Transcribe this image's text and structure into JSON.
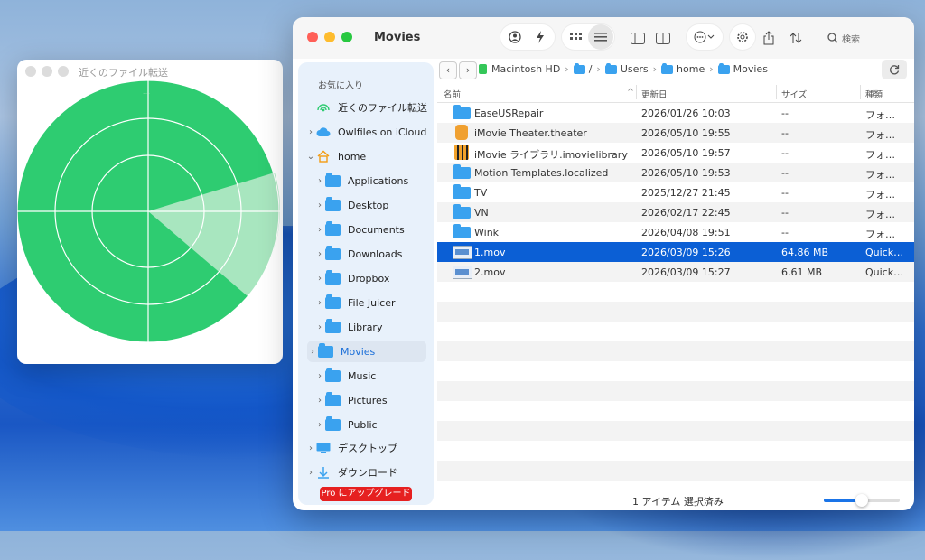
{
  "airdrop_window": {
    "title": "近くのファイル転送",
    "radar_label": "…",
    "colors": {
      "radar": "#2ecc71",
      "sweep": "#a8e6bf"
    }
  },
  "finder": {
    "title": "Movies",
    "search_placeholder": "検索",
    "toolbar_icons": [
      "person-circle-icon",
      "bolt-icon",
      "grid-view-icon",
      "list-view-icon",
      "sidebar-toggle-icon",
      "split-view-icon",
      "more-options-icon",
      "gear-icon",
      "share-icon",
      "sort-icon",
      "search-icon"
    ],
    "sidebar": {
      "section_title": "お気に入り",
      "items": [
        {
          "label": "近くのファイル転送",
          "icon": "airdrop-icon",
          "expandable": false
        },
        {
          "label": "Owlfiles on iCloud",
          "icon": "cloud-icon",
          "expandable": true
        },
        {
          "label": "home",
          "icon": "home-icon",
          "expandable": true,
          "expanded": true
        },
        {
          "label": "Applications",
          "icon": "folder-icon",
          "expandable": true,
          "child": true
        },
        {
          "label": "Desktop",
          "icon": "folder-icon",
          "expandable": true,
          "child": true
        },
        {
          "label": "Documents",
          "icon": "folder-icon",
          "expandable": true,
          "child": true
        },
        {
          "label": "Downloads",
          "icon": "folder-icon",
          "expandable": true,
          "child": true
        },
        {
          "label": "Dropbox",
          "icon": "folder-icon",
          "expandable": true,
          "child": true
        },
        {
          "label": "File Juicer",
          "icon": "folder-icon",
          "expandable": true,
          "child": true
        },
        {
          "label": "Library",
          "icon": "folder-icon",
          "expandable": true,
          "child": true
        },
        {
          "label": "Movies",
          "icon": "folder-icon",
          "expandable": true,
          "child": true,
          "active": true
        },
        {
          "label": "Music",
          "icon": "folder-icon",
          "expandable": true,
          "child": true
        },
        {
          "label": "Pictures",
          "icon": "folder-icon",
          "expandable": true,
          "child": true
        },
        {
          "label": "Public",
          "icon": "folder-icon",
          "expandable": true,
          "child": true
        },
        {
          "label": "デスクトップ",
          "icon": "desktop-icon",
          "expandable": true
        },
        {
          "label": "ダウンロード",
          "icon": "download-icon",
          "expandable": true
        }
      ],
      "pro_button": "Pro にアップグレード"
    },
    "path": [
      "Macintosh HD",
      "/",
      "Users",
      "home",
      "Movies"
    ],
    "columns": {
      "name": "名前",
      "date": "更新日",
      "size": "サイズ",
      "kind": "種類"
    },
    "files": [
      {
        "name": "EaseUSRepair",
        "date": "2026/01/26 10:03",
        "size": "--",
        "kind": "フォ…",
        "icon": "folder"
      },
      {
        "name": "iMovie Theater.theater",
        "date": "2026/05/10 19:55",
        "size": "--",
        "kind": "フォ…",
        "icon": "theater"
      },
      {
        "name": "iMovie ライブラリ.imovielibrary",
        "date": "2026/05/10 19:57",
        "size": "--",
        "kind": "フォ…",
        "icon": "lib"
      },
      {
        "name": "Motion Templates.localized",
        "date": "2026/05/10 19:53",
        "size": "--",
        "kind": "フォ…",
        "icon": "folder"
      },
      {
        "name": "TV",
        "date": "2025/12/27 21:45",
        "size": "--",
        "kind": "フォ…",
        "icon": "folder"
      },
      {
        "name": "VN",
        "date": "2026/02/17 22:45",
        "size": "--",
        "kind": "フォ…",
        "icon": "folder"
      },
      {
        "name": "Wink",
        "date": "2026/04/08 19:51",
        "size": "--",
        "kind": "フォ…",
        "icon": "folder"
      },
      {
        "name": "1.mov",
        "date": "2026/03/09 15:26",
        "size": "64.86 MB",
        "kind": "Quick…",
        "icon": "mov",
        "selected": true
      },
      {
        "name": "2.mov",
        "date": "2026/03/09 15:27",
        "size": "6.61 MB",
        "kind": "Quick…",
        "icon": "mov"
      }
    ],
    "status": "1 アイテム 選択済み",
    "zoom_level": 0.5,
    "accent_color": "#0b5fd5"
  }
}
